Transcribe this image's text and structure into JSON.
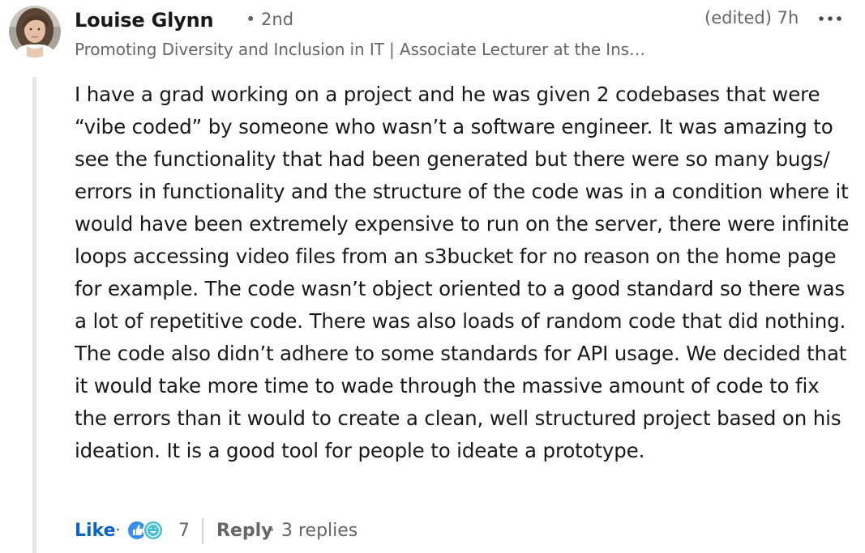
{
  "comment": {
    "author": {
      "name": "Louise Glynn",
      "degree": "• 2nd",
      "headline": "Promoting Diversity and Inclusion in IT | Associate Lecturer at the Ins…"
    },
    "meta": {
      "edited_time": "(edited) 7h"
    },
    "more_icon": "ellipsis-icon",
    "body": "I have a grad working on a project and he was given 2 codebases that were “vibe coded” by someone who wasn’t a software engineer. It was amazing to see the functionality that had been generated but there were so many bugs/ errors in functionality and the structure of the code was in a condition where it would have been extremely expensive to run on the server, there were infinite loops accessing video files from an s3bucket for no reason on the home page for example. The code wasn’t object oriented to a good standard so there was a lot of repetitive code. There was also loads of random code that did nothing. The code also didn’t adhere to some standards for API usage. We decided that it would take more time to wade through the massive amount of code to fix the errors than it would to create a clean, well structured project based on his ideation. It is a good tool for people to ideate a prototype.",
    "actions": {
      "like_label": "Like",
      "separator": "·",
      "reaction_icons": [
        "like-reaction-icon",
        "funny-reaction-icon"
      ],
      "reaction_count": "7",
      "reply_label": "Reply",
      "replies_text": "3 replies"
    }
  },
  "colors": {
    "link_blue": "#0a66c2",
    "muted_text": "#666666",
    "body_text": "#191919",
    "thread_line": "#e6e6e6"
  }
}
